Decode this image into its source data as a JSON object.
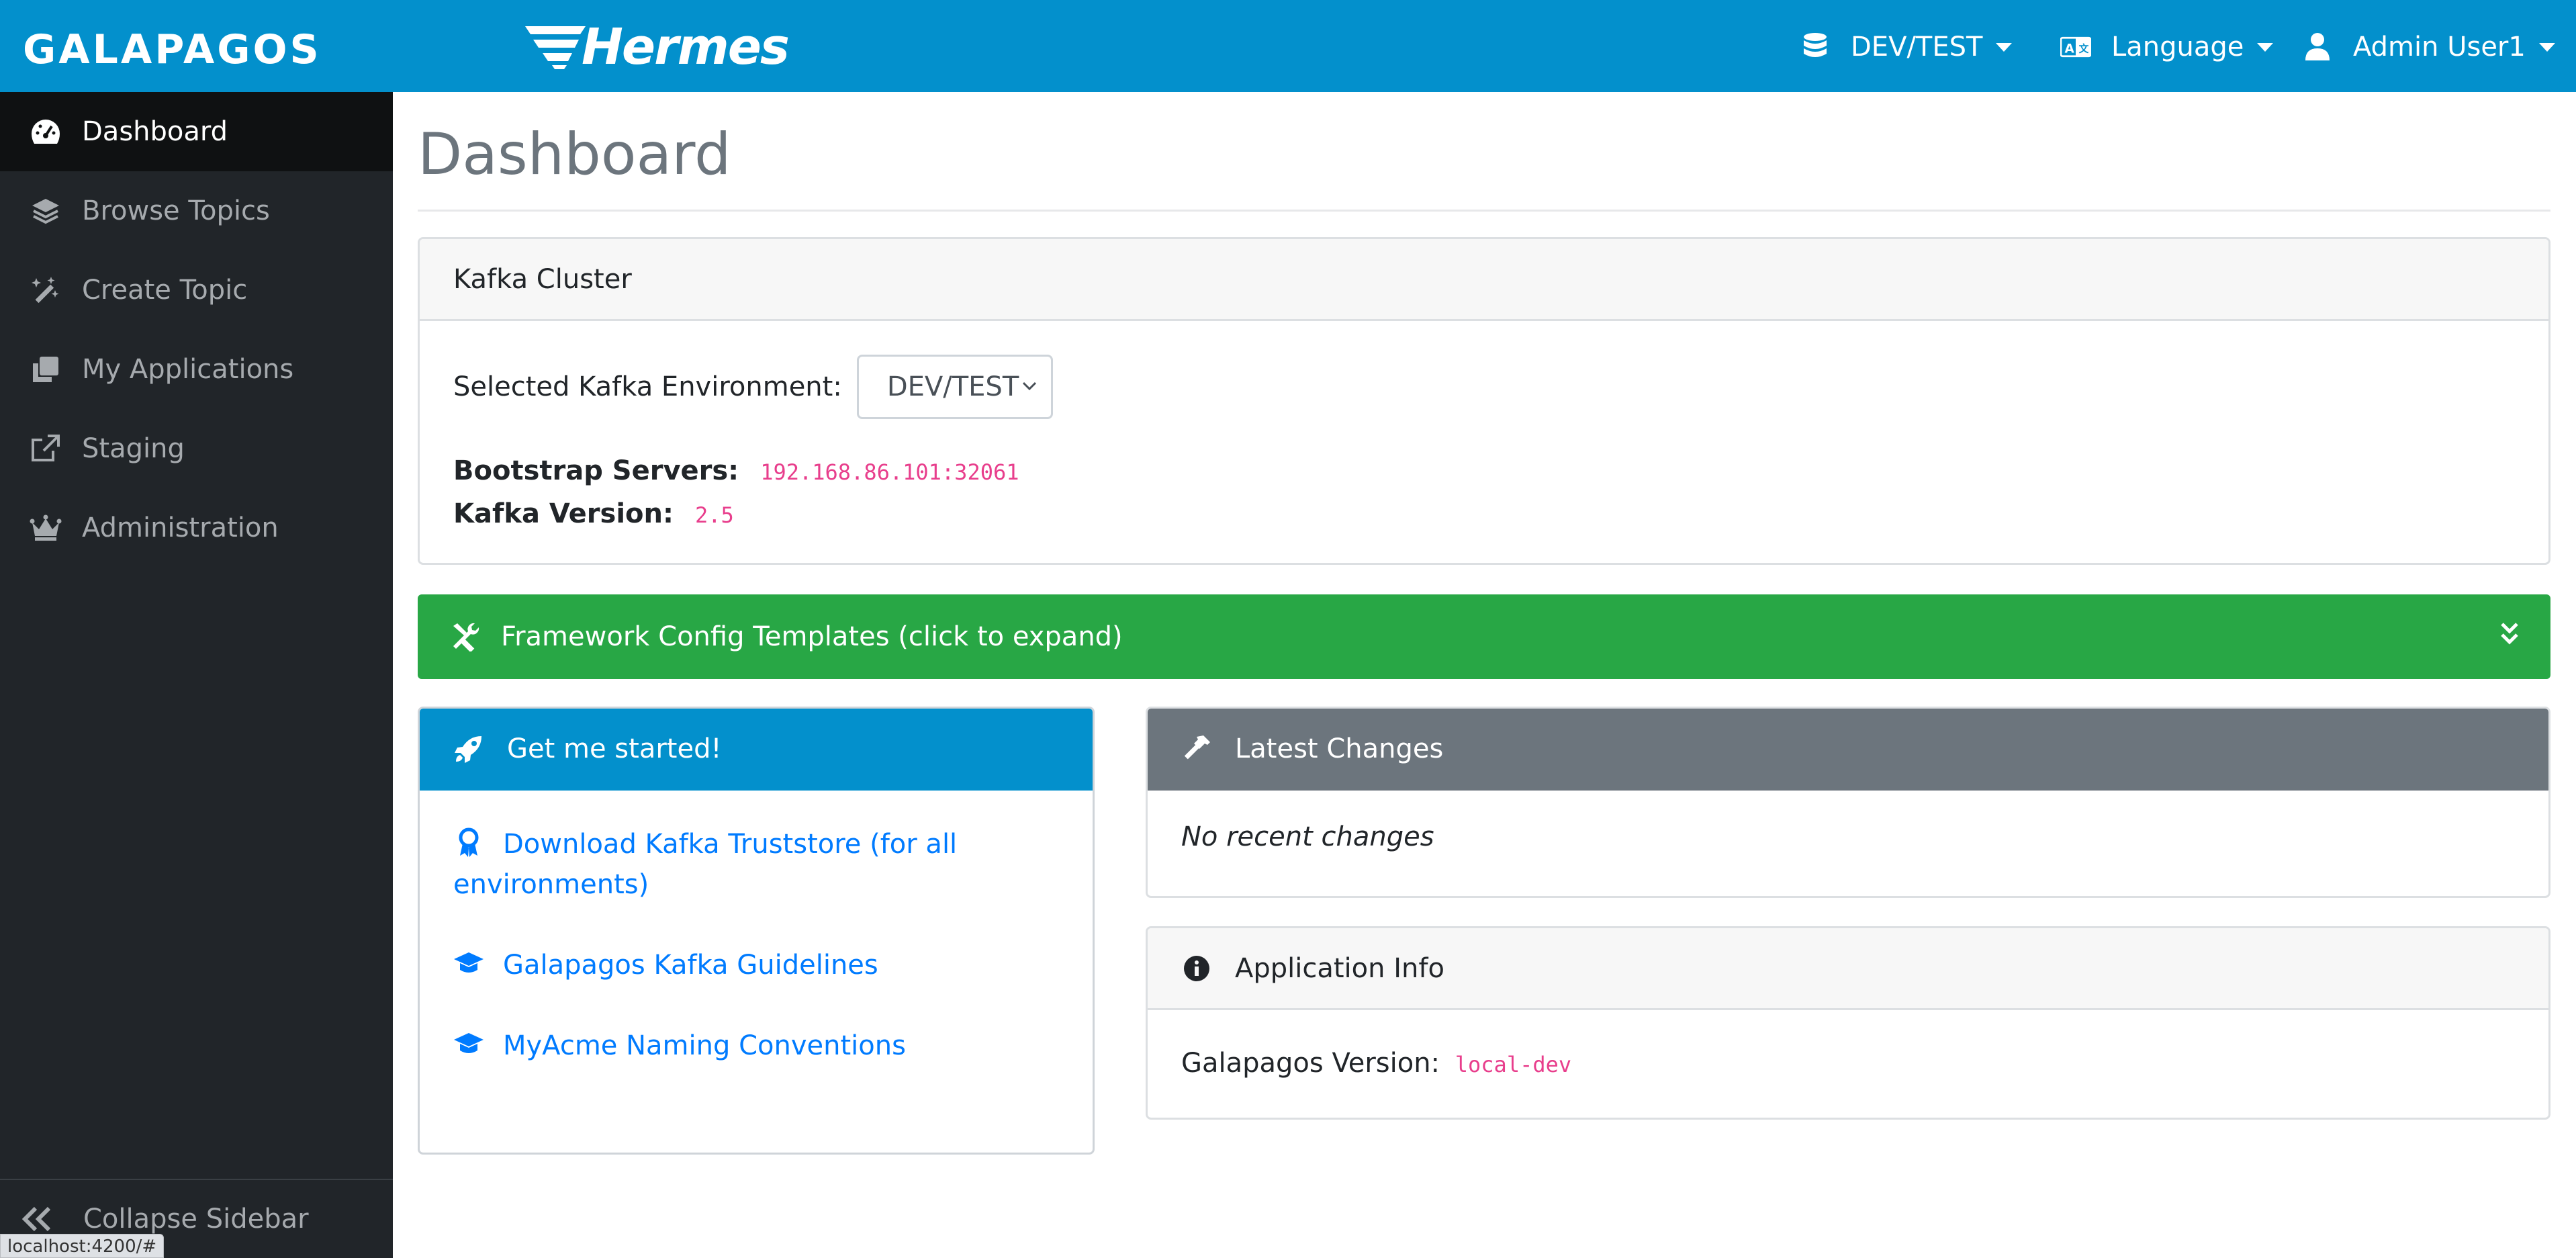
{
  "navbar": {
    "brand": "GALAPAGOS",
    "hermes_logo_text": "Hermes",
    "environment_dropdown": "DEV/TEST",
    "language_dropdown": "Language",
    "user_dropdown": "Admin User1",
    "accent_color": "#0390cc"
  },
  "sidebar": {
    "items": [
      {
        "label": "Dashboard",
        "icon": "gauge-icon",
        "active": true
      },
      {
        "label": "Browse Topics",
        "icon": "layers-icon",
        "active": false
      },
      {
        "label": "Create Topic",
        "icon": "magic-wand-icon",
        "active": false
      },
      {
        "label": "My Applications",
        "icon": "clone-icon",
        "active": false
      },
      {
        "label": "Staging",
        "icon": "external-link-icon",
        "active": false
      },
      {
        "label": "Administration",
        "icon": "crown-icon",
        "active": false
      }
    ],
    "collapse_label": "Collapse Sidebar"
  },
  "status_bar_url": "localhost:4200/#",
  "main": {
    "page_title": "Dashboard",
    "kafka_cluster": {
      "header": "Kafka Cluster",
      "env_label": "Selected Kafka Environment:",
      "env_value": "DEV/TEST",
      "bootstrap_label": "Bootstrap Servers:",
      "bootstrap_value": "192.168.86.101:32061",
      "version_label": "Kafka Version:",
      "version_value": "2.5"
    },
    "framework_templates": {
      "label": "Framework Config Templates (click to expand)",
      "color": "#28a745"
    },
    "get_started": {
      "header": "Get me started!",
      "links": [
        {
          "line1": "Download Kafka Truststore (for all",
          "line2": "environments)",
          "icon": "award-icon"
        },
        {
          "line1": "Galapagos Kafka Guidelines",
          "icon": "graduation-cap-icon"
        },
        {
          "line1": "MyAcme Naming Conventions",
          "icon": "graduation-cap-icon"
        }
      ]
    },
    "latest_changes": {
      "header": "Latest Changes",
      "empty_text": "No recent changes"
    },
    "application_info": {
      "header": "Application Info",
      "version_label": "Galapagos Version:",
      "version_value": "local-dev"
    }
  }
}
